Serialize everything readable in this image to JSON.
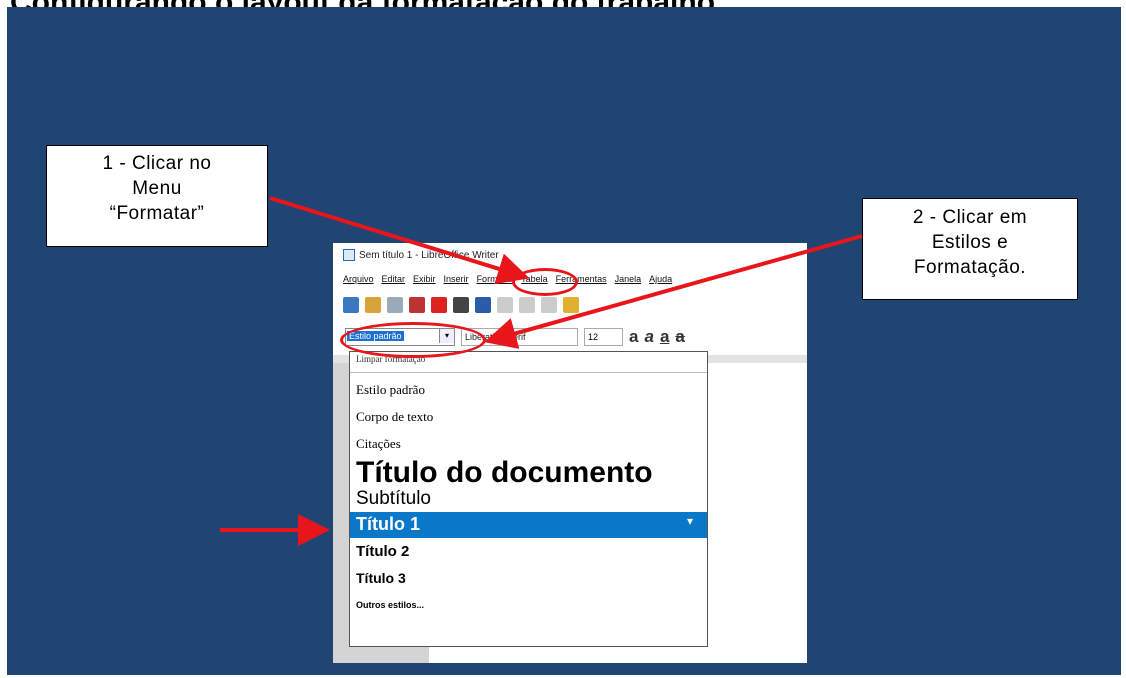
{
  "heading": "Configurando o layout da formatação do trabalho",
  "callouts": {
    "one": [
      "1 - Clicar no",
      "Menu",
      "“Formatar”"
    ],
    "two": [
      "2 - Clicar em",
      "Estilos e",
      "Formatação."
    ]
  },
  "window": {
    "title": "Sem título 1 - LibreOffice Writer",
    "menu": [
      "Arquivo",
      "Editar",
      "Exibir",
      "Inserir",
      "Formatar",
      "Tabela",
      "Ferramentas",
      "Janela",
      "Ajuda"
    ],
    "style_value": "Estilo padrão",
    "font_value": "Liberation Serif",
    "size_value": "12"
  },
  "dropdown": {
    "clear": "Limpar formatação",
    "items": [
      "Estilo padrão",
      "Corpo de texto",
      "Citações",
      "Título do documento",
      "Subtítulo",
      "Título 1",
      "Título 2",
      "Título 3",
      "Outros estilos..."
    ]
  },
  "colors": {
    "slide_bg": "#204474",
    "arrow_red": "#e8161b",
    "highlight": "#0a78c8"
  }
}
